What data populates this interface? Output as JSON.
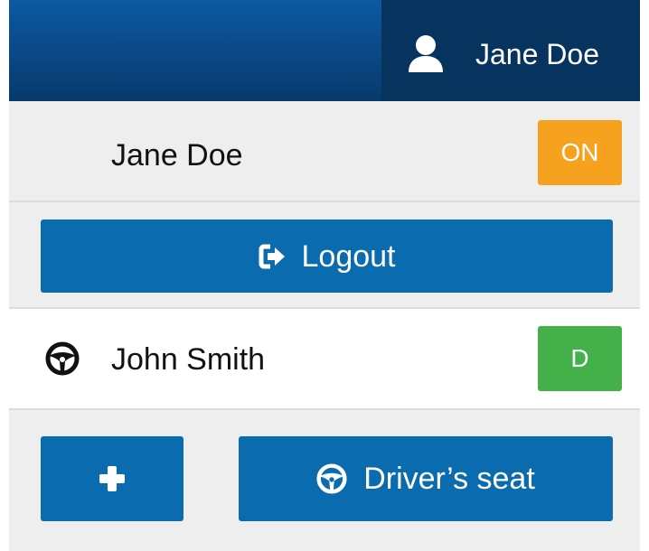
{
  "header": {
    "user_name": "Jane Doe",
    "user_icon": "user-icon"
  },
  "current_user": {
    "name": "Jane Doe",
    "status_badge": "ON",
    "status_color": "#f6a21f"
  },
  "logout": {
    "label": "Logout",
    "icon": "sign-out-icon"
  },
  "driver": {
    "name": "John Smith",
    "icon": "steering-wheel-icon",
    "badge": "D",
    "badge_color": "#43b049"
  },
  "actions": {
    "add_icon": "plus-icon",
    "drivers_seat_label": "Driver’s seat",
    "drivers_seat_icon": "steering-wheel-icon"
  },
  "colors": {
    "primary": "#0a6cae",
    "header_dark": "#07335f"
  }
}
